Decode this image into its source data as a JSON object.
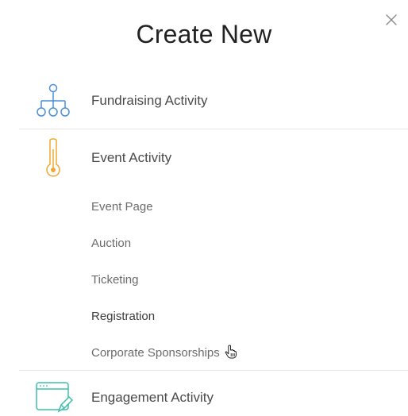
{
  "modal": {
    "title": "Create New",
    "close_icon": "close-icon"
  },
  "sections": {
    "fundraising": {
      "label": "Fundraising Activity",
      "icon": "org-chart-icon",
      "icon_color": "#4a90d9"
    },
    "event": {
      "label": "Event Activity",
      "icon": "thermometer-icon",
      "icon_color": "#f0a830",
      "items": [
        {
          "label": "Event Page"
        },
        {
          "label": "Auction"
        },
        {
          "label": "Ticketing"
        },
        {
          "label": "Registration"
        },
        {
          "label": "Corporate Sponsorships"
        }
      ]
    },
    "engagement": {
      "label": "Engagement Activity",
      "icon": "browser-edit-icon",
      "icon_color": "#3dbfa8"
    }
  },
  "cursor": {
    "icon": "hand-pointer-icon"
  }
}
